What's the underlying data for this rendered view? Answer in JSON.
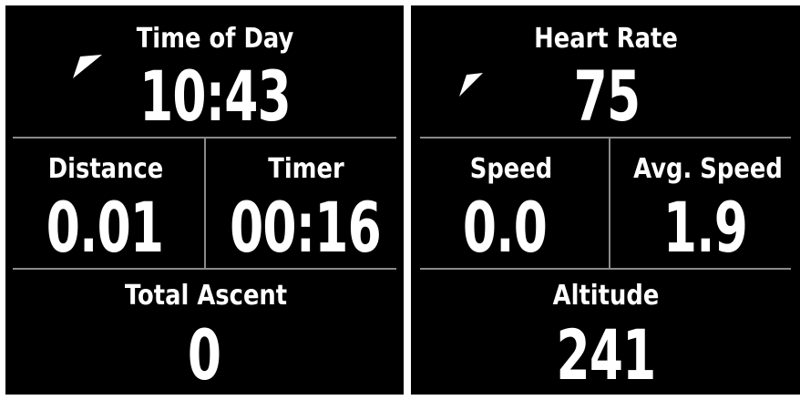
{
  "screens": [
    {
      "top": {
        "label": "Time of Day",
        "value": "10:43"
      },
      "mid_left": {
        "label": "Distance",
        "value": "0.01"
      },
      "mid_right": {
        "label": "Timer",
        "value": "00:16"
      },
      "bottom": {
        "label": "Total Ascent",
        "value": "0"
      }
    },
    {
      "top": {
        "label": "Heart Rate",
        "value": "75"
      },
      "mid_left": {
        "label": "Speed",
        "value": "0.0"
      },
      "mid_right": {
        "label": "Avg. Speed",
        "value": "1.9"
      },
      "bottom": {
        "label": "Altitude",
        "value": "241"
      }
    }
  ],
  "colors": {
    "background": "#000000",
    "text": "#ffffff",
    "divider": "#8a8a8a"
  }
}
